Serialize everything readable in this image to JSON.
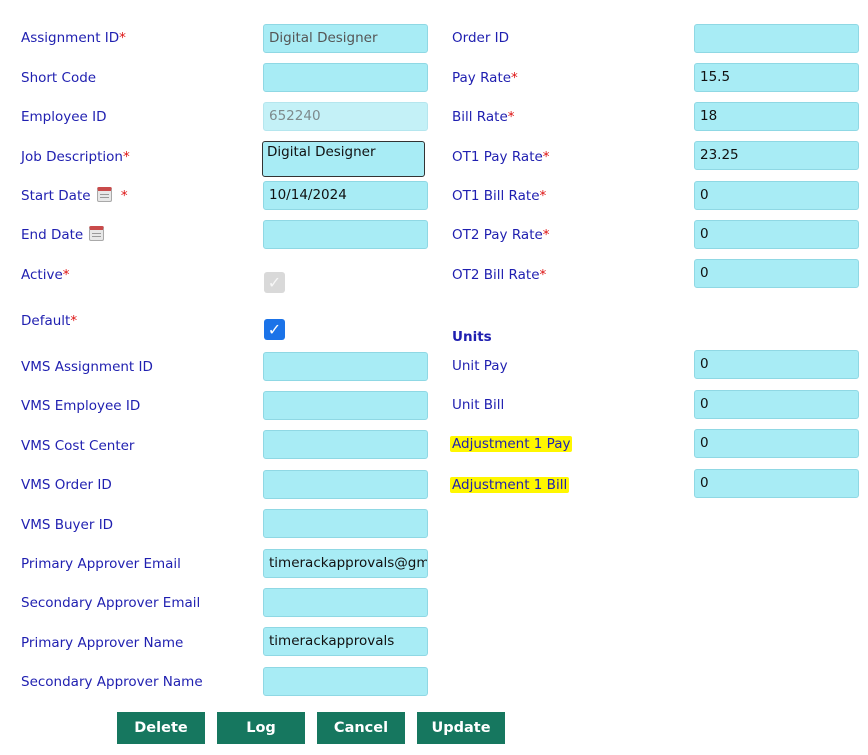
{
  "left": {
    "assignment_id": {
      "label": "Assignment ID",
      "value": "Digital Designer"
    },
    "short_code": {
      "label": "Short Code",
      "value": ""
    },
    "employee_id": {
      "label": "Employee ID",
      "value": "652240"
    },
    "job_description": {
      "label": "Job Description",
      "value": "Digital Designer"
    },
    "start_date": {
      "label": "Start Date",
      "value": "10/14/2024"
    },
    "end_date": {
      "label": "End Date",
      "value": ""
    },
    "active": {
      "label": "Active",
      "checked": true
    },
    "default": {
      "label": "Default",
      "checked": true
    },
    "vms_assignment_id": {
      "label": "VMS Assignment ID",
      "value": ""
    },
    "vms_employee_id": {
      "label": "VMS Employee ID",
      "value": ""
    },
    "vms_cost_center": {
      "label": "VMS Cost Center",
      "value": ""
    },
    "vms_order_id": {
      "label": "VMS Order ID",
      "value": ""
    },
    "vms_buyer_id": {
      "label": "VMS Buyer ID",
      "value": ""
    },
    "primary_approver_email": {
      "label": "Primary Approver Email",
      "value": "timerackapprovals@gmai"
    },
    "secondary_approver_email": {
      "label": "Secondary Approver Email",
      "value": ""
    },
    "primary_approver_name": {
      "label": "Primary Approver Name",
      "value": "timerackapprovals"
    },
    "secondary_approver_name": {
      "label": "Secondary Approver Name",
      "value": ""
    }
  },
  "right": {
    "order_id": {
      "label": "Order ID",
      "value": ""
    },
    "pay_rate": {
      "label": "Pay Rate",
      "value": "15.5"
    },
    "bill_rate": {
      "label": "Bill Rate",
      "value": "18"
    },
    "ot1_pay_rate": {
      "label": "OT1 Pay Rate",
      "value": "23.25"
    },
    "ot1_bill_rate": {
      "label": "OT1 Bill Rate",
      "value": "0"
    },
    "ot2_pay_rate": {
      "label": "OT2 Pay Rate",
      "value": "0"
    },
    "ot2_bill_rate": {
      "label": "OT2 Bill Rate",
      "value": "0"
    },
    "units_heading": "Units",
    "unit_pay": {
      "label": "Unit Pay",
      "value": "0"
    },
    "unit_bill": {
      "label": "Unit Bill",
      "value": "0"
    },
    "adjustment_1_pay": {
      "label": "Adjustment 1 Pay",
      "value": "0"
    },
    "adjustment_1_bill": {
      "label": "Adjustment 1 Bill",
      "value": "0"
    }
  },
  "required_marker": "*",
  "checkmark": "✓",
  "buttons": {
    "delete": "Delete",
    "log": "Log",
    "cancel": "Cancel",
    "update": "Update"
  },
  "colors": {
    "label": "#1f1fb0",
    "required": "#dd1111",
    "input_bg": "#a8ecf5",
    "button_bg": "#16775f",
    "highlight": "#fff700",
    "checkbox_on": "#1b73e8"
  }
}
